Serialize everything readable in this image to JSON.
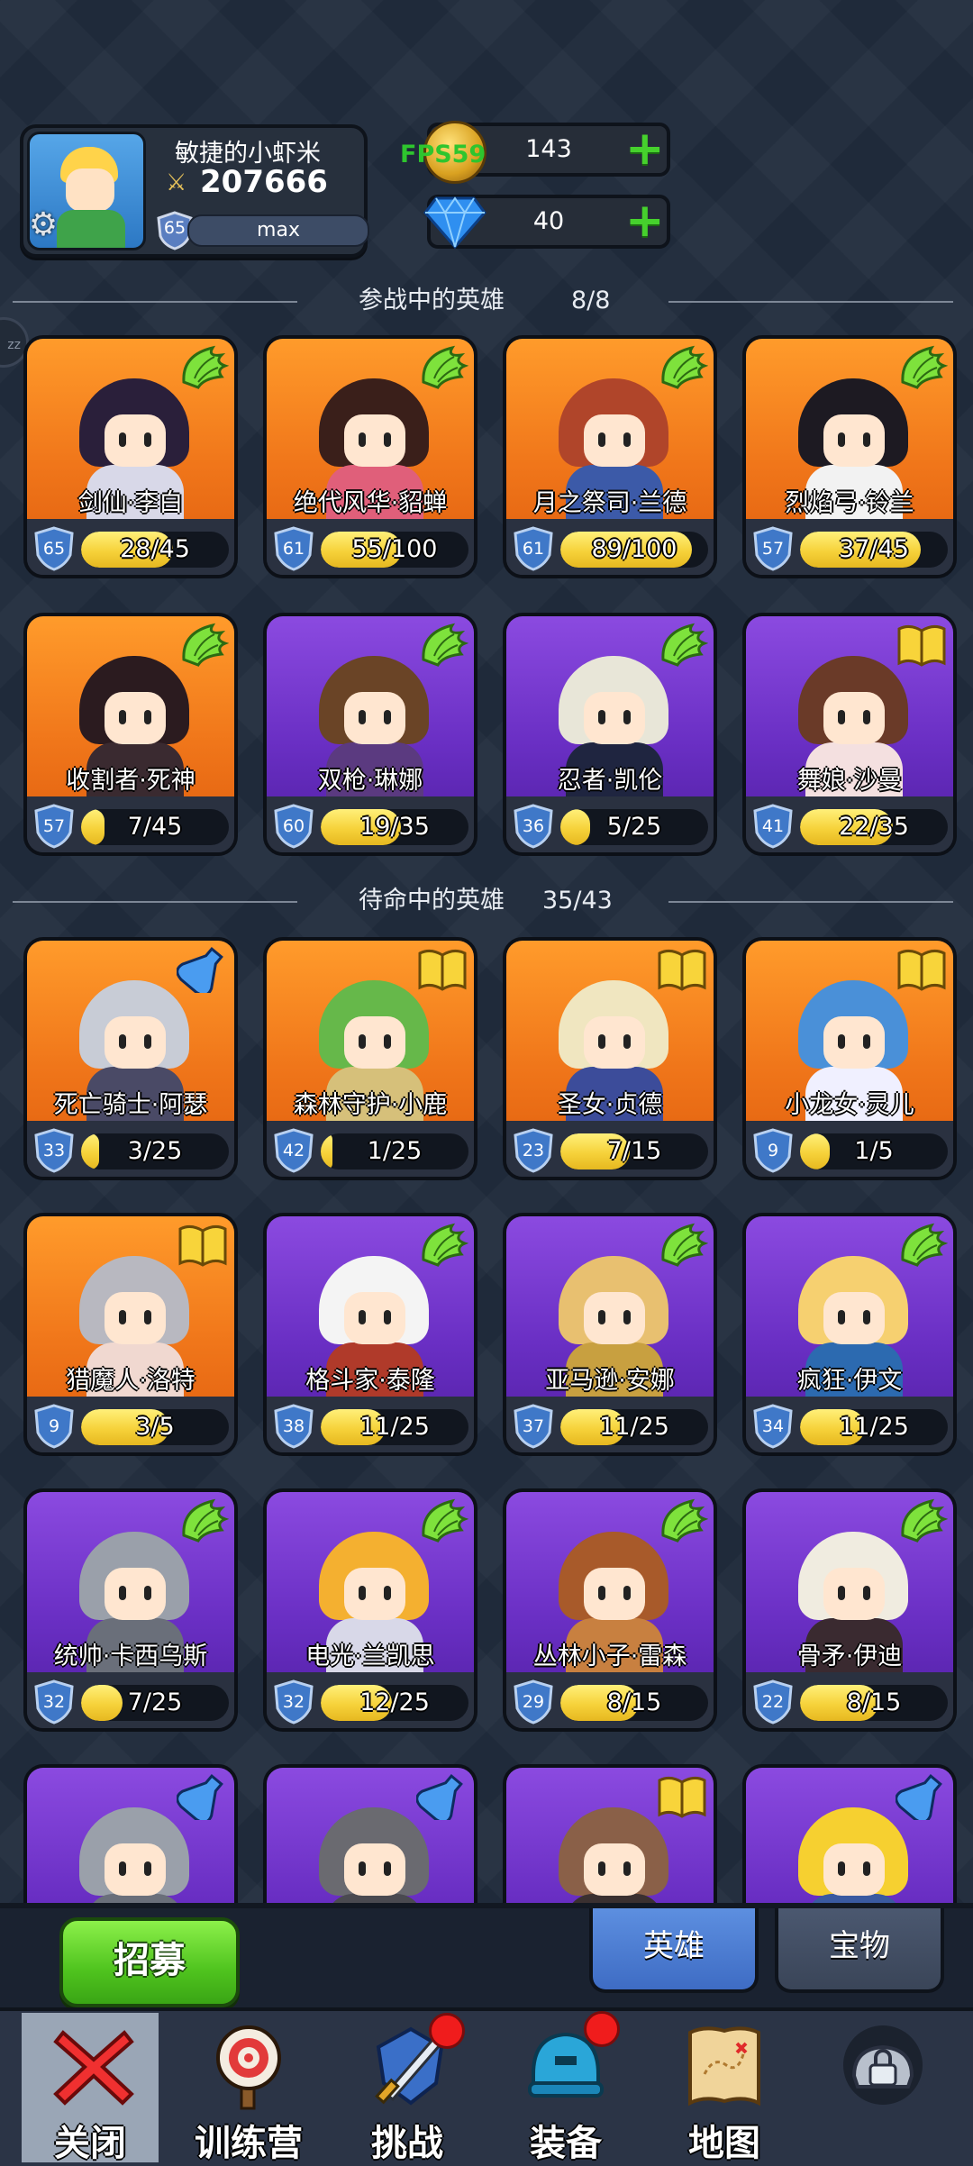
{
  "player": {
    "name": "敏捷的小虾米",
    "power": "207666",
    "level": "65",
    "exp_label": "max"
  },
  "fps": "FPS59",
  "resources": {
    "gold": "143",
    "gems": "40"
  },
  "sections": {
    "active": {
      "title": "参战中的英雄",
      "count": "8/8"
    },
    "standby": {
      "title": "待命中的英雄",
      "count": "35/43"
    }
  },
  "heroes": [
    {
      "name": "剑仙·李白",
      "level": "65",
      "progress": "28/45",
      "fill": 0.62,
      "bg": "orange",
      "badge": "wing-icon",
      "hood": "#2a1f3a",
      "torso": "#d8d8e8"
    },
    {
      "name": "绝代风华·貂蝉",
      "level": "61",
      "progress": "55/100",
      "fill": 0.55,
      "bg": "orange",
      "badge": "wing-icon",
      "hood": "#3a1f1a",
      "torso": "#e05f7a"
    },
    {
      "name": "月之祭司·兰德",
      "level": "61",
      "progress": "89/100",
      "fill": 0.89,
      "bg": "orange",
      "badge": "wing-icon",
      "hood": "#b0452a",
      "torso": "#3c5aa8"
    },
    {
      "name": "烈焰弓·铃兰",
      "level": "57",
      "progress": "37/45",
      "fill": 0.82,
      "bg": "orange",
      "badge": "wing-icon",
      "hood": "#1d1a22",
      "torso": "#f2f2f2"
    },
    {
      "name": "收割者·死神",
      "level": "57",
      "progress": "7/45",
      "fill": 0.16,
      "bg": "orange",
      "badge": "wing-icon",
      "hood": "#2b1b1f",
      "torso": "#3a2a30"
    },
    {
      "name": "双枪·琳娜",
      "level": "60",
      "progress": "19/35",
      "fill": 0.54,
      "bg": "purple",
      "badge": "wing-icon",
      "hood": "#6a4426",
      "torso": "#5b3a80"
    },
    {
      "name": "忍者·凯伦",
      "level": "36",
      "progress": "5/25",
      "fill": 0.2,
      "bg": "purple",
      "badge": "wing-icon",
      "hood": "#e8e6d8",
      "torso": "#1f2540"
    },
    {
      "name": "舞娘·沙曼",
      "level": "41",
      "progress": "22/35",
      "fill": 0.63,
      "bg": "purple",
      "badge": "book-icon",
      "hood": "#6a3a28",
      "torso": "#f4e0e0"
    },
    {
      "name": "死亡骑士·阿瑟",
      "level": "33",
      "progress": "3/25",
      "fill": 0.12,
      "bg": "orange",
      "badge": "potion-icon",
      "hood": "#c8ccd6",
      "torso": "#4a4a66"
    },
    {
      "name": "森林守护·小鹿",
      "level": "42",
      "progress": "1/25",
      "fill": 0.04,
      "bg": "orange",
      "badge": "book-icon",
      "hood": "#66b84a",
      "torso": "#d6c07a"
    },
    {
      "name": "圣女·贞德",
      "level": "23",
      "progress": "7/15",
      "fill": 0.47,
      "bg": "orange",
      "badge": "book-icon",
      "hood": "#f0e6c0",
      "torso": "#3c4c9a"
    },
    {
      "name": "小龙女·灵儿",
      "level": "9",
      "progress": "1/5",
      "fill": 0.2,
      "bg": "orange",
      "badge": "book-icon",
      "hood": "#4a90d8",
      "torso": "#f0f0ff"
    },
    {
      "name": "猎魔人·洛特",
      "level": "9",
      "progress": "3/5",
      "fill": 0.6,
      "bg": "orange",
      "badge": "book-icon",
      "hood": "#b8b8c0",
      "torso": "#f0d8d0"
    },
    {
      "name": "格斗家·泰隆",
      "level": "38",
      "progress": "11/25",
      "fill": 0.44,
      "bg": "purple",
      "badge": "wing-icon",
      "hood": "#f4f4f4",
      "torso": "#b03a2a"
    },
    {
      "name": "亚马逊·安娜",
      "level": "37",
      "progress": "11/25",
      "fill": 0.44,
      "bg": "purple",
      "badge": "wing-icon",
      "hood": "#e8c070",
      "torso": "#c8a040"
    },
    {
      "name": "疯狂·伊文",
      "level": "34",
      "progress": "11/25",
      "fill": 0.44,
      "bg": "purple",
      "badge": "wing-icon",
      "hood": "#f6d070",
      "torso": "#2c6ab0"
    },
    {
      "name": "统帅·卡西乌斯",
      "level": "32",
      "progress": "7/25",
      "fill": 0.28,
      "bg": "purple",
      "badge": "wing-icon",
      "hood": "#9aa0aa",
      "torso": "#6a6f7a"
    },
    {
      "name": "电光·兰凯思",
      "level": "32",
      "progress": "12/25",
      "fill": 0.48,
      "bg": "purple",
      "badge": "wing-icon",
      "hood": "#f4b030",
      "torso": "#d8d8e8"
    },
    {
      "name": "丛林小子·雷森",
      "level": "29",
      "progress": "8/15",
      "fill": 0.53,
      "bg": "purple",
      "badge": "wing-icon",
      "hood": "#a85a2a",
      "torso": "#c88040"
    },
    {
      "name": "骨矛·伊迪",
      "level": "22",
      "progress": "8/15",
      "fill": 0.53,
      "bg": "purple",
      "badge": "wing-icon",
      "hood": "#f0ece0",
      "torso": "#3a2a30"
    },
    {
      "name": "",
      "level": "",
      "progress": "",
      "fill": 0,
      "bg": "purple",
      "badge": "potion-icon",
      "hood": "#9aa0aa",
      "torso": "#6a6f7a"
    },
    {
      "name": "",
      "level": "",
      "progress": "",
      "fill": 0,
      "bg": "purple",
      "badge": "potion-icon",
      "hood": "#6a6a70",
      "torso": "#4a4a50"
    },
    {
      "name": "",
      "level": "",
      "progress": "",
      "fill": 0,
      "bg": "purple",
      "badge": "book-icon",
      "hood": "#8a6048",
      "torso": "#3a3030"
    },
    {
      "name": "",
      "level": "",
      "progress": "",
      "fill": 0,
      "bg": "purple",
      "badge": "potion-icon",
      "hood": "#f6d030",
      "torso": "#3a5aa0"
    }
  ],
  "bottom": {
    "recruit_label": "招募",
    "tabs": [
      {
        "label": "英雄",
        "active": true
      },
      {
        "label": "宝物",
        "active": false
      }
    ],
    "nav": [
      {
        "label": "关闭",
        "icon": "close-icon",
        "badge": false
      },
      {
        "label": "训练营",
        "icon": "target-icon",
        "badge": false
      },
      {
        "label": "挑战",
        "icon": "sword-icon",
        "badge": true
      },
      {
        "label": "装备",
        "icon": "helmet-icon",
        "badge": true
      },
      {
        "label": "地图",
        "icon": "map-icon",
        "badge": false
      },
      {
        "label": "",
        "icon": "locked-icon",
        "badge": false
      }
    ]
  },
  "colors": {
    "orange_card": "#f0761a",
    "purple_card": "#6a2fc4",
    "accent_green": "#46d12d",
    "fps_green": "#2ec52e"
  }
}
